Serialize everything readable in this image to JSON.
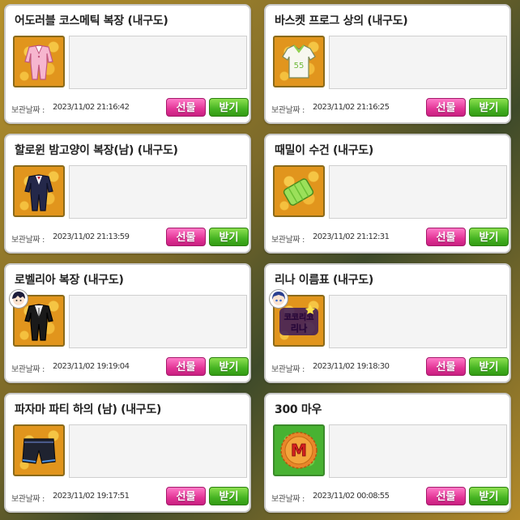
{
  "date_label": "보관날짜 :",
  "buttons": {
    "gift": "선물",
    "receive": "받기"
  },
  "cards": [
    {
      "title": "어도러블 코스메틱 복장 (내구도)",
      "date": "2023/11/02 21:16:42",
      "icon": "pink-suit-icon"
    },
    {
      "title": "바스켓 프로그 상의 (내구도)",
      "date": "2023/11/02 21:16:25",
      "icon": "white-jersey-icon"
    },
    {
      "title": "할로윈 밤고양이 복장(남) (내구도)",
      "date": "2023/11/02 21:13:59",
      "icon": "dark-suit-icon"
    },
    {
      "title": "때밀이 수건 (내구도)",
      "date": "2023/11/02 21:12:31",
      "icon": "green-towel-icon"
    },
    {
      "title": "로벨리아 복장 (내구도)",
      "date": "2023/11/02 19:19:04",
      "icon": "black-outfit-icon"
    },
    {
      "title": "리나 이름표 (내구도)",
      "date": "2023/11/02 19:18:30",
      "icon": "name-tag-icon"
    },
    {
      "title": "파자마 파티 하의 (남) (내구도)",
      "date": "2023/11/02 19:17:51",
      "icon": "shorts-icon"
    },
    {
      "title": "300 마우",
      "date": "2023/11/02 00:08:55",
      "icon": "mau-coin-icon"
    }
  ],
  "name_tag_text": [
    "코코리코",
    "리나"
  ],
  "coin_letter": "M",
  "colors": {
    "gift_button": "#e23496",
    "receive_button": "#45b322",
    "item_frame": "#e1951d",
    "coin_frame": "#48b232"
  }
}
